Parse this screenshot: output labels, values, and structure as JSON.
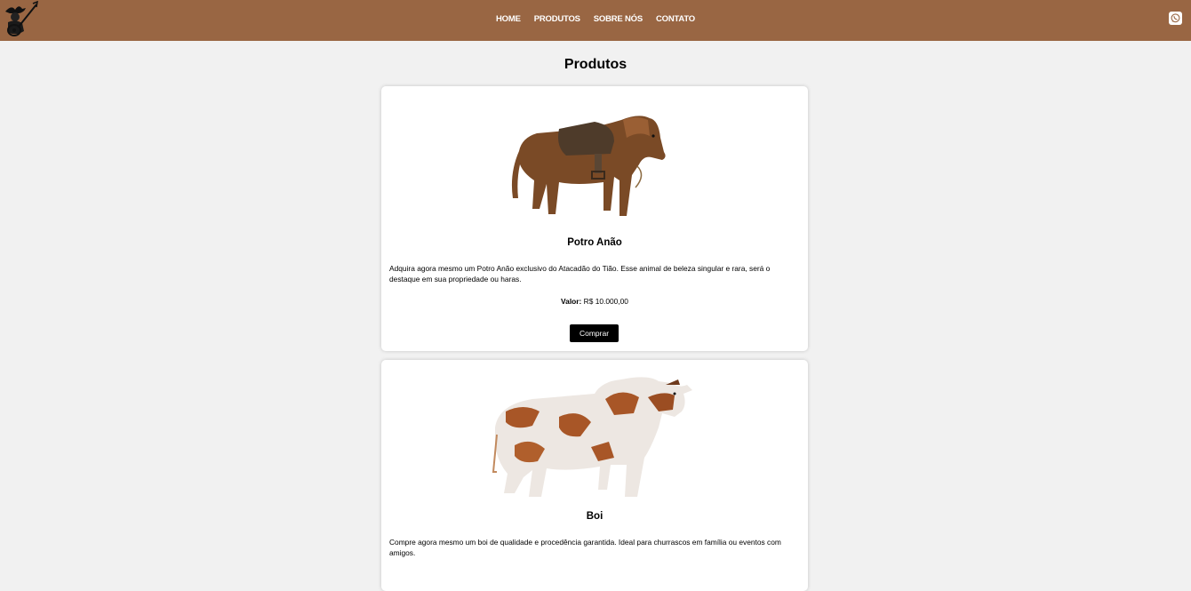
{
  "header": {
    "logo_icon": "cowboy-guitar-logo-icon",
    "nav": [
      {
        "label": "HOME"
      },
      {
        "label": "PRODUTOS"
      },
      {
        "label": "SOBRE NÓS"
      },
      {
        "label": "CONTATO"
      }
    ],
    "whatsapp_icon": "whatsapp-icon",
    "background": "#996643"
  },
  "main": {
    "title": "Produtos",
    "products": [
      {
        "image_icon": "pony-icon",
        "name": "Potro Anão",
        "description": "Adquira agora mesmo um Potro Anão exclusivo do Atacadão do Tião. Esse animal de beleza singular e rara, será o destaque em sua propriedade ou haras.",
        "price_label": "Valor:",
        "price": "R$ 10.000,00",
        "button": "Comprar"
      },
      {
        "image_icon": "bull-icon",
        "name": "Boi",
        "description": "Compre agora mesmo um boi de qualidade e procedência garantida. Ideal para churrascos em família ou eventos com amigos."
      }
    ]
  }
}
